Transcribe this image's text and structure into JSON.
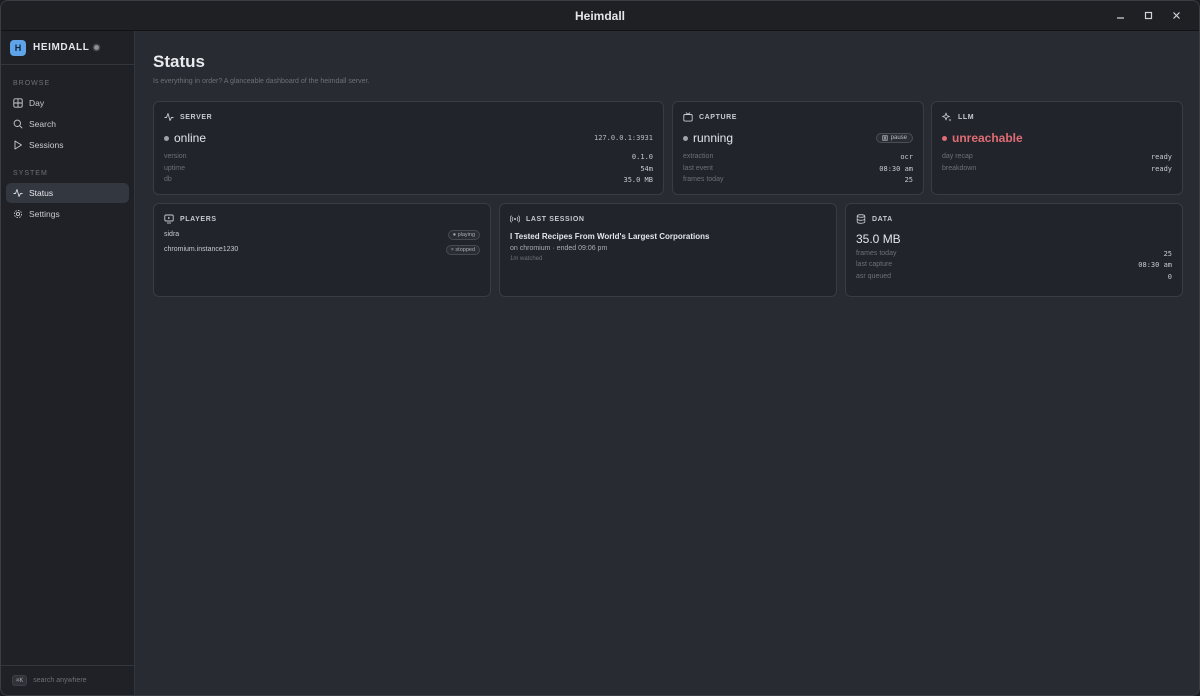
{
  "window": {
    "title": "Heimdall"
  },
  "sidebar": {
    "brand": {
      "logo_letter": "H",
      "name": "HEIMDALL"
    },
    "sections": [
      {
        "label": "BROWSE",
        "items": [
          {
            "label": "Day",
            "icon": "grid-icon"
          },
          {
            "label": "Search",
            "icon": "search-icon"
          },
          {
            "label": "Sessions",
            "icon": "play-icon"
          }
        ]
      },
      {
        "label": "SYSTEM",
        "items": [
          {
            "label": "Status",
            "icon": "activity-icon",
            "active": true
          },
          {
            "label": "Settings",
            "icon": "gear-icon"
          }
        ]
      }
    ],
    "footer": {
      "shortcut": "⌘K",
      "label": "search anywhere"
    }
  },
  "page": {
    "title": "Status",
    "subtitle": "Is everything in order? A glanceable dashboard of the heimdall server."
  },
  "server": {
    "label": "SERVER",
    "status": "online",
    "address": "127.0.0.1:3931",
    "rows": [
      {
        "k": "version",
        "v": "0.1.0"
      },
      {
        "k": "uptime",
        "v": "54m"
      },
      {
        "k": "db",
        "v": "35.0 MB"
      }
    ]
  },
  "capture": {
    "label": "CAPTURE",
    "status": "running",
    "action": "pause",
    "rows": [
      {
        "k": "extraction",
        "v": "ocr"
      },
      {
        "k": "last event",
        "v": "08:30 am"
      },
      {
        "k": "frames today",
        "v": "25"
      }
    ]
  },
  "llm": {
    "label": "LLM",
    "status": "unreachable",
    "rows": [
      {
        "k": "day recap",
        "v": "ready"
      },
      {
        "k": "breakdown",
        "v": "ready"
      }
    ]
  },
  "players": {
    "label": "PLAYERS",
    "items": [
      {
        "name": "sidra",
        "state": "● playing"
      },
      {
        "name": "chromium.instance1230",
        "state": "× stopped"
      }
    ]
  },
  "last_session": {
    "label": "LAST SESSION",
    "title": "I Tested Recipes From World's Largest Corporations",
    "meta": "on chromium · ended 09:06 pm",
    "watched": "1m watched"
  },
  "data": {
    "label": "DATA",
    "size": "35.0 MB",
    "rows": [
      {
        "k": "frames today",
        "v": "25"
      },
      {
        "k": "last capture",
        "v": "08:30 am"
      },
      {
        "k": "asr queued",
        "v": "0"
      }
    ]
  },
  "colors": {
    "accent": "#5fa3e8",
    "ok": "#9ea2a9",
    "error": "#e06c75"
  }
}
